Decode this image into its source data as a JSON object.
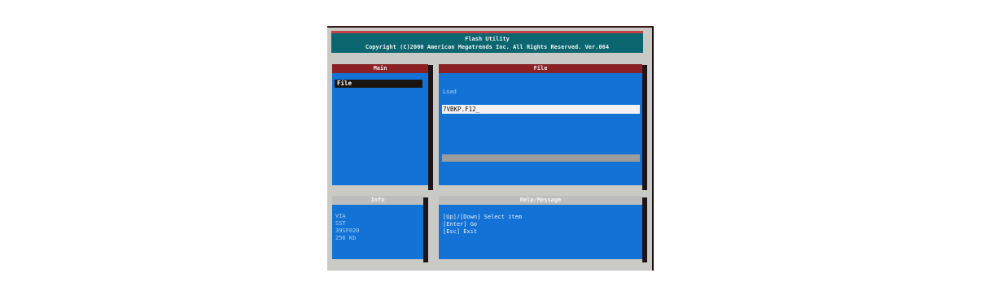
{
  "header": {
    "title": "Flash Utility",
    "copyright": "Copyright (C)2000 American Megatrends Inc. All Rights Reserved. Ver.064"
  },
  "main_panel": {
    "title": "Main",
    "items": [
      "File",
      "",
      "",
      "",
      "",
      ""
    ],
    "selected_index": 0
  },
  "file_panel": {
    "title": "File",
    "load_label": "Load",
    "load_path": "",
    "input_value": "7VBKP.F12_",
    "save_label": "",
    "save_path": ""
  },
  "info_panel": {
    "title": "Info",
    "rows": [
      {
        "label": "",
        "value": "VIA"
      },
      {
        "label": "",
        "value": "SST"
      },
      {
        "label": "",
        "value": "39SF020"
      },
      {
        "label": "",
        "value": "256 Kb"
      },
      {
        "label": "",
        "value": ""
      }
    ]
  },
  "help_panel": {
    "title": "Help/Message",
    "lines": [
      "[Up]/[Down] Select item",
      "[Enter] Go",
      "[Esc] Exit"
    ]
  },
  "colors": {
    "panel_blue": "#1372d6",
    "header_red": "#8b2125",
    "title_teal": "#0b6670",
    "frame_grey": "#c9c9c6"
  }
}
